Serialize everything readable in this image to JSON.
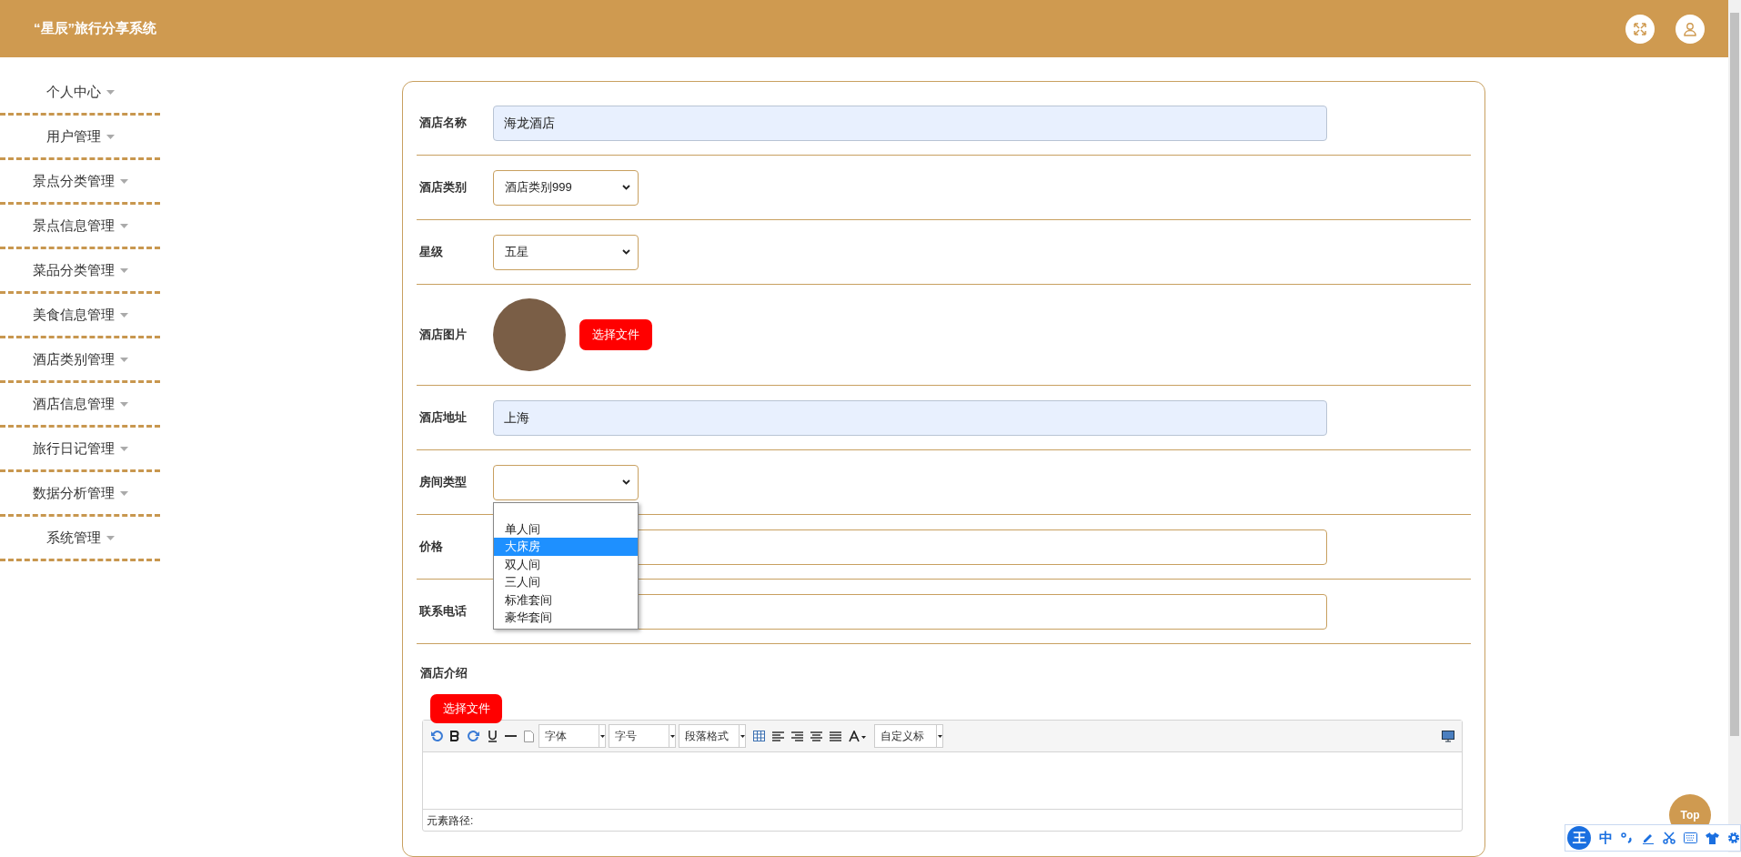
{
  "header": {
    "title": "“星辰”旅行分享系统"
  },
  "sidebar": {
    "items": [
      {
        "label": "个人中心"
      },
      {
        "label": "用户管理"
      },
      {
        "label": "景点分类管理"
      },
      {
        "label": "景点信息管理"
      },
      {
        "label": "菜品分类管理"
      },
      {
        "label": "美食信息管理"
      },
      {
        "label": "酒店类别管理"
      },
      {
        "label": "酒店信息管理"
      },
      {
        "label": "旅行日记管理"
      },
      {
        "label": "数据分析管理"
      },
      {
        "label": "系统管理"
      }
    ]
  },
  "form": {
    "fields": [
      {
        "kind": "text",
        "label": "酒店名称",
        "value": "海龙酒店",
        "autofilled": true
      },
      {
        "kind": "select",
        "label": "酒店类别",
        "value": "酒店类别999"
      },
      {
        "kind": "select",
        "label": "星级",
        "value": "五星"
      },
      {
        "kind": "image",
        "label": "酒店图片",
        "button": "选择文件"
      },
      {
        "kind": "text",
        "label": "酒店地址",
        "value": "上海",
        "autofilled": true
      },
      {
        "kind": "select",
        "label": "房间类型",
        "open": true,
        "options": [
          {
            "label": "单人间",
            "selected": false
          },
          {
            "label": "大床房",
            "selected": true
          },
          {
            "label": "双人间",
            "selected": false
          },
          {
            "label": "三人间",
            "selected": false
          },
          {
            "label": "标准套间",
            "selected": false
          },
          {
            "label": "豪华套间",
            "selected": false
          }
        ]
      },
      {
        "kind": "text",
        "label": "价格",
        "autofilled": false
      },
      {
        "kind": "text",
        "label": "联系电话",
        "autofilled": false
      }
    ],
    "editor": {
      "label": "酒店介绍",
      "upload_button": "选择文件",
      "font": "字体",
      "size": "字号",
      "paragraph": "段落格式",
      "heading": "自定义标",
      "path_label": "元素路径:"
    }
  },
  "top_button": "Top",
  "ime": {
    "logo": "王",
    "mode": "中"
  }
}
